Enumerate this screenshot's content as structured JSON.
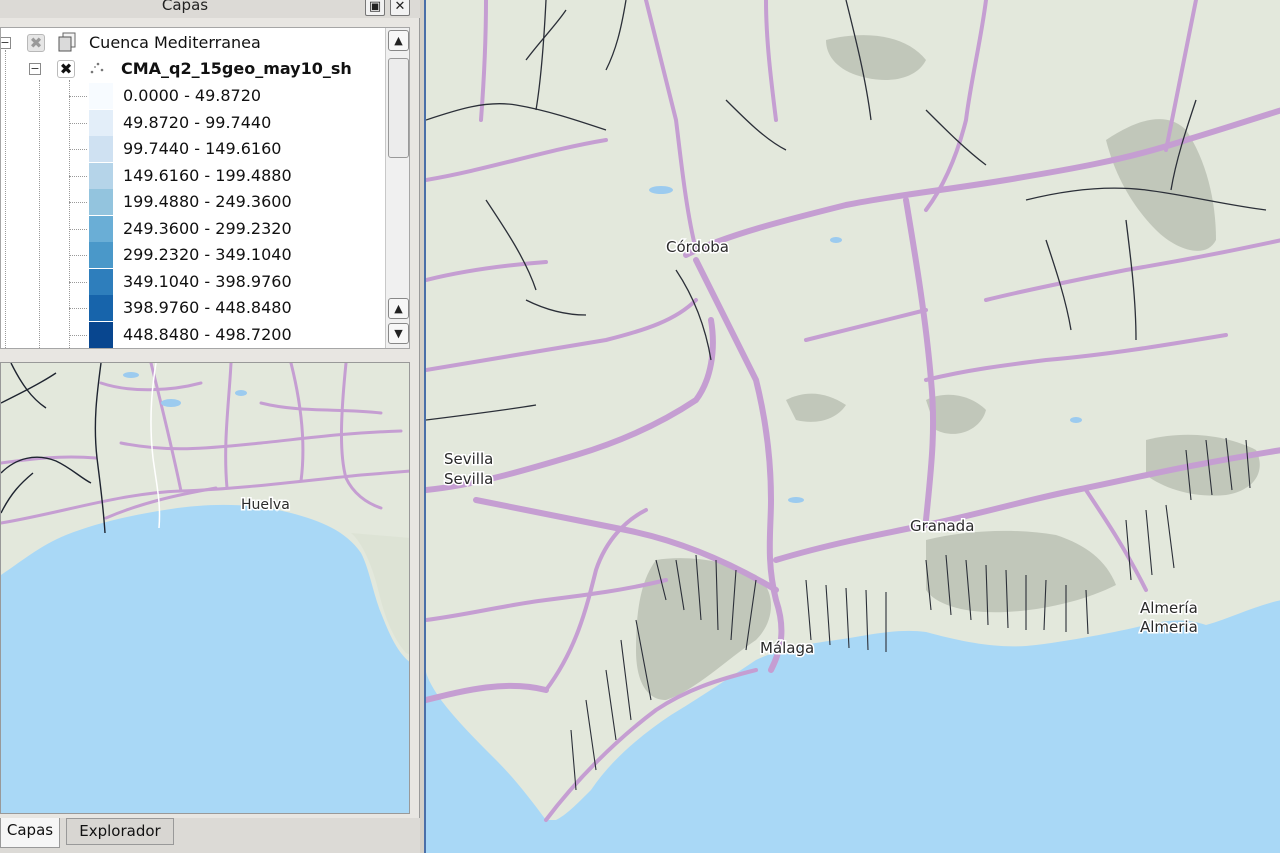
{
  "dock": {
    "title": "Capas"
  },
  "layers": {
    "group": {
      "label": "Cuenca Mediterranea"
    },
    "layer": {
      "label": "CMA_q2_15geo_may10_sh"
    },
    "legend": [
      {
        "label": "0.0000 - 49.8720",
        "color": "#f7fbff"
      },
      {
        "label": "49.8720 - 99.7440",
        "color": "#e3eef9"
      },
      {
        "label": "99.7440 - 149.6160",
        "color": "#cfe1f2"
      },
      {
        "label": "149.6160 - 199.4880",
        "color": "#b5d4e9"
      },
      {
        "label": "199.4880 - 249.3600",
        "color": "#93c4de"
      },
      {
        "label": "249.3600 - 299.2320",
        "color": "#6aaed6"
      },
      {
        "label": "299.2320 - 349.1040",
        "color": "#4a98c9"
      },
      {
        "label": "349.1040 - 398.9760",
        "color": "#2e7ebc"
      },
      {
        "label": "398.9760 - 448.8480",
        "color": "#1764ab"
      },
      {
        "label": "448.8480 - 498.7200",
        "color": "#08468f"
      }
    ]
  },
  "overview": {
    "city": "Huelva"
  },
  "tabs": {
    "capas": "Capas",
    "explorador": "Explorador"
  },
  "map": {
    "cities": {
      "cordoba": "Córdoba",
      "sevilla_1": "Sevilla",
      "sevilla_2": "Sevilla",
      "granada": "Granada",
      "malaga": "Málaga",
      "almeria_1": "Almería",
      "almeria_2": "Almeria"
    },
    "colors": {
      "land": "#e3e8dc",
      "sea": "#a9d8f6",
      "roads": "#c59ed2",
      "rivers": "#2b2f38",
      "mountains": "#9fa59a"
    }
  }
}
